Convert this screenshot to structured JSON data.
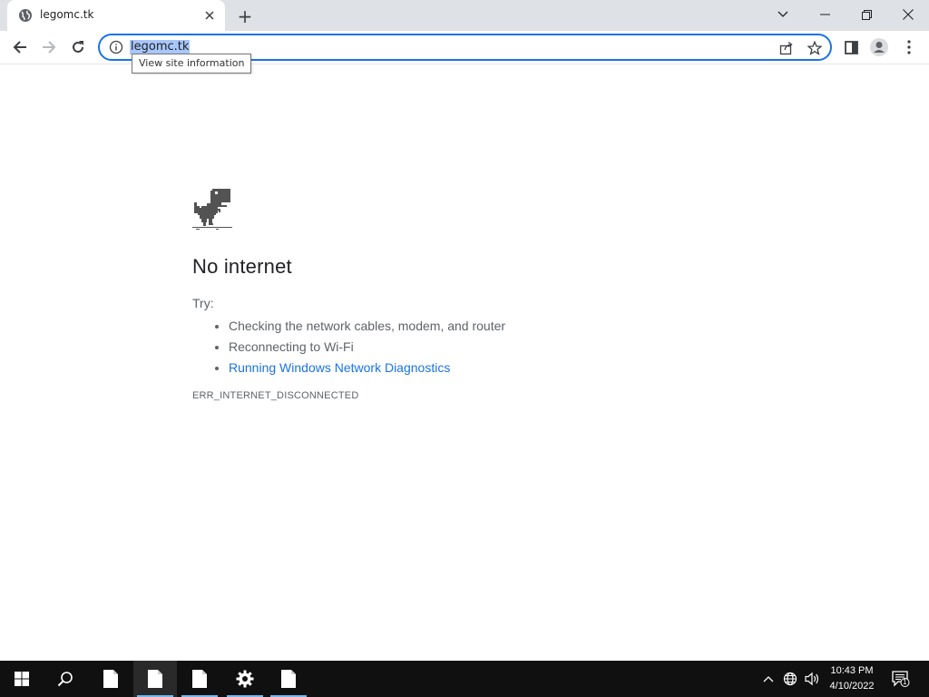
{
  "browser": {
    "tab": {
      "title": "legomc.tk",
      "favicon": "globe-icon"
    },
    "new_tab_symbol": "+",
    "window_controls": [
      "tab-search-icon",
      "minimize-icon",
      "restore-icon",
      "close-icon"
    ],
    "toolbar": {
      "url": "legomc.tk",
      "tooltip": "View site information",
      "buttons": [
        "back-icon",
        "forward-icon",
        "reload-icon",
        "share-icon",
        "star-icon",
        "side-panel-icon",
        "profile-icon",
        "menu-icon"
      ]
    }
  },
  "error_page": {
    "title": "No internet",
    "try_label": "Try:",
    "suggestions": [
      {
        "text": "Checking the network cables, modem, and router",
        "link": false
      },
      {
        "text": "Reconnecting to Wi-Fi",
        "link": false
      },
      {
        "text": "Running Windows Network Diagnostics",
        "link": true
      }
    ],
    "error_code": "ERR_INTERNET_DISCONNECTED"
  },
  "taskbar": {
    "time": "10:43 PM",
    "date": "4/10/2022",
    "notification_count": "1",
    "items": [
      "windows-start-icon",
      "search-icon",
      "file-icon",
      "file-icon",
      "file-icon",
      "settings-gear-icon",
      "file-icon"
    ]
  },
  "colors": {
    "accent": "#1a73e8",
    "tabstrip": "#dee1e6",
    "taskbar": "#101010",
    "text_secondary": "#5f6368"
  }
}
